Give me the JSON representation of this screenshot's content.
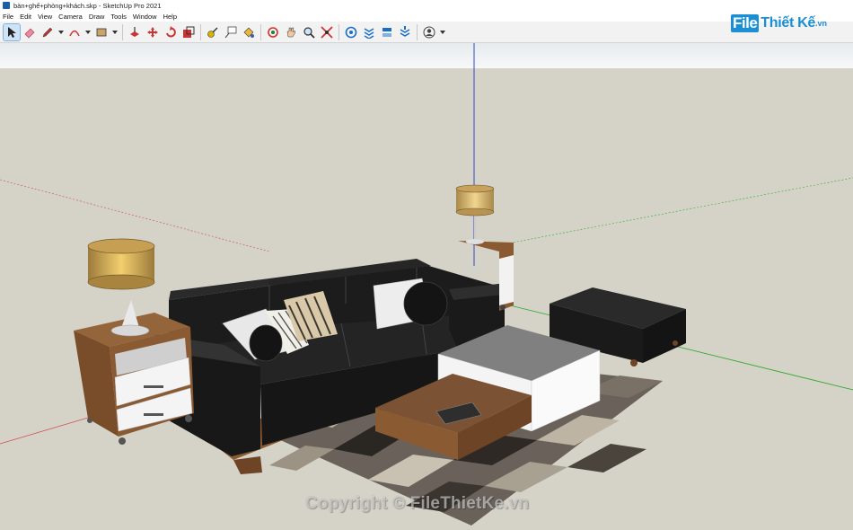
{
  "window": {
    "title": "bàn+ghế+phòng+khách.skp - SketchUp Pro 2021"
  },
  "menu": {
    "items": [
      "File",
      "Edit",
      "View",
      "Camera",
      "Draw",
      "Tools",
      "Window",
      "Help"
    ]
  },
  "toolbar": {
    "tools": [
      "select-tool",
      "eraser-tool",
      "pencil-line-tool",
      "arc-tool",
      "rectangle-tool",
      "push-pull-tool",
      "move-tool",
      "rotate-tool",
      "scale-tool",
      "offset-tool",
      "tape-measure-tool",
      "text-tool",
      "paint-bucket-tool",
      "orbit-tool",
      "pan-tool",
      "zoom-tool",
      "zoom-extents-tool",
      "3d-warehouse-icon",
      "extension-warehouse-icon",
      "layout-icon",
      "extension-manager-icon",
      "account-icon"
    ]
  },
  "logo": {
    "part1": "File",
    "part2": "Thiết Kế",
    "part3": ".vn"
  },
  "watermark": {
    "text": "Copyright © FileThietKe.vn"
  },
  "colors": {
    "sky": "#f4f6f7",
    "ground": "#d5d3c8",
    "sofa": "#1c1c1c",
    "wood": "#8a5a33",
    "axis_red": "#d04a4a",
    "axis_green": "#33aa33",
    "axis_blue": "#3344cc",
    "accent": "#1a8fd6"
  }
}
